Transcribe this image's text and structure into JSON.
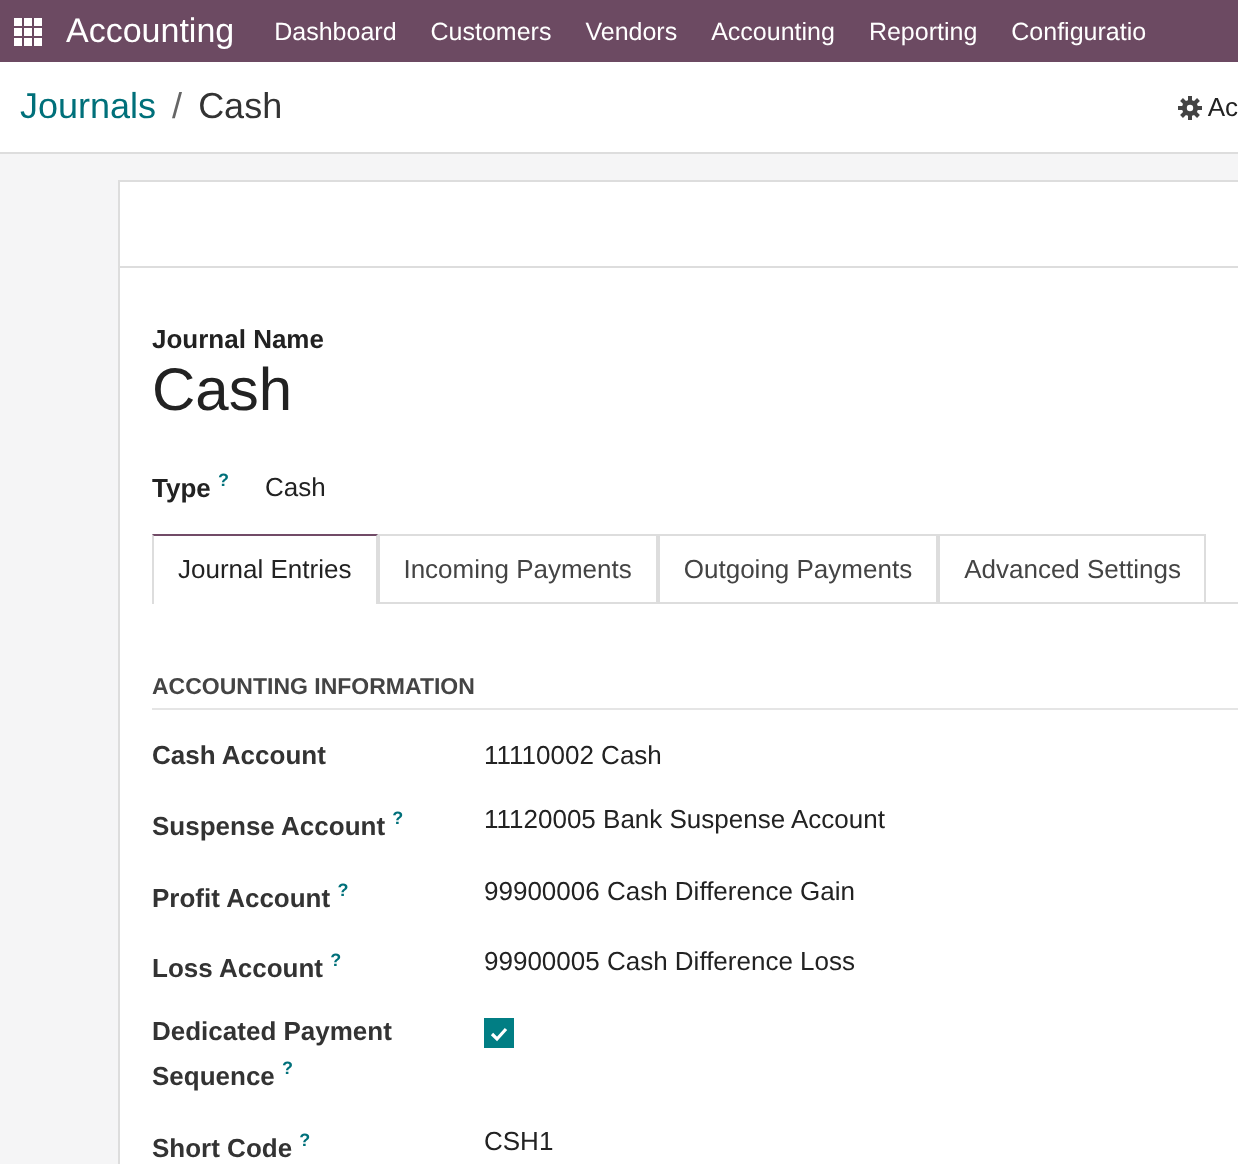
{
  "navbar": {
    "app_name": "Accounting",
    "menu": [
      "Dashboard",
      "Customers",
      "Vendors",
      "Accounting",
      "Reporting",
      "Configuratio"
    ]
  },
  "breadcrumb": {
    "parent": "Journals",
    "separator": "/",
    "current": "Cash",
    "action": "Ac"
  },
  "form": {
    "name_label": "Journal Name",
    "name": "Cash",
    "type_label": "Type $^{?}$",
    "type_value": "Cash",
    "tabs": [
      {
        "label": "Journal Entries",
        "selected": true
      },
      {
        "label": "Incoming Payments",
        "selected": false
      },
      {
        "label": "Outgoing Payments",
        "selected": false
      },
      {
        "label": "Advanced Settings",
        "selected": false
      }
    ],
    "section_title": "ACCOUNTING INFORMATION",
    "fields": [
      {
        "kind": "text",
        "label": "Cash Account",
        "value": "11110002 Cash"
      },
      {
        "kind": "text",
        "label": "Suspense Account $^{?}$",
        "value": "11120005 Bank Suspense Account"
      },
      {
        "kind": "text",
        "label": "Profit Account $^{?}$",
        "value": "99900006 Cash Difference Gain"
      },
      {
        "kind": "text",
        "label": "Loss Account $^{?}$",
        "value": "99900005 Cash Difference Loss"
      },
      {
        "kind": "checkbox",
        "label": "Dedicated Payment Sequence $^{?}$",
        "checked": true
      },
      {
        "kind": "text",
        "label": "Short Code $^{?}$",
        "value": "CSH1"
      }
    ]
  }
}
